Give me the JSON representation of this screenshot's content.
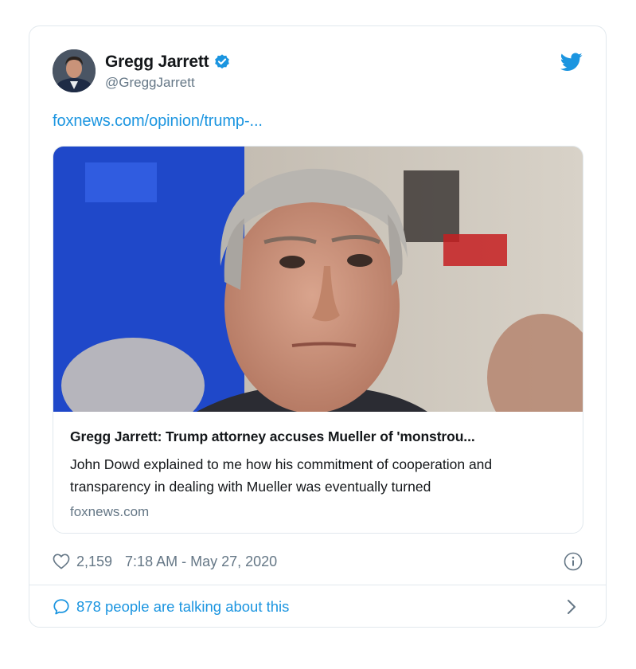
{
  "tweet": {
    "author": {
      "display_name": "Gregg Jarrett",
      "handle": "@GreggJarrett",
      "verified": true
    },
    "link_text": "foxnews.com/opinion/trump-...",
    "card": {
      "title": "Gregg Jarrett: Trump attorney accuses Mueller of 'monstrou...",
      "description": "John Dowd explained to me how his commitment of cooperation and transparency in dealing with Mueller was eventually turned",
      "domain": "foxnews.com"
    },
    "likes": "2,159",
    "timestamp": "7:18 AM - May 27, 2020",
    "talking_about": "878 people are talking about this"
  },
  "icons": {
    "verified": "verified-badge-icon",
    "brand": "twitter-bird-icon",
    "like": "heart-icon",
    "info": "info-icon",
    "reply": "speech-bubble-icon",
    "more": "chevron-right-icon"
  },
  "colors": {
    "accent": "#1b95e0",
    "text": "#14171a",
    "muted": "#657786",
    "border": "#e1e8ed"
  }
}
